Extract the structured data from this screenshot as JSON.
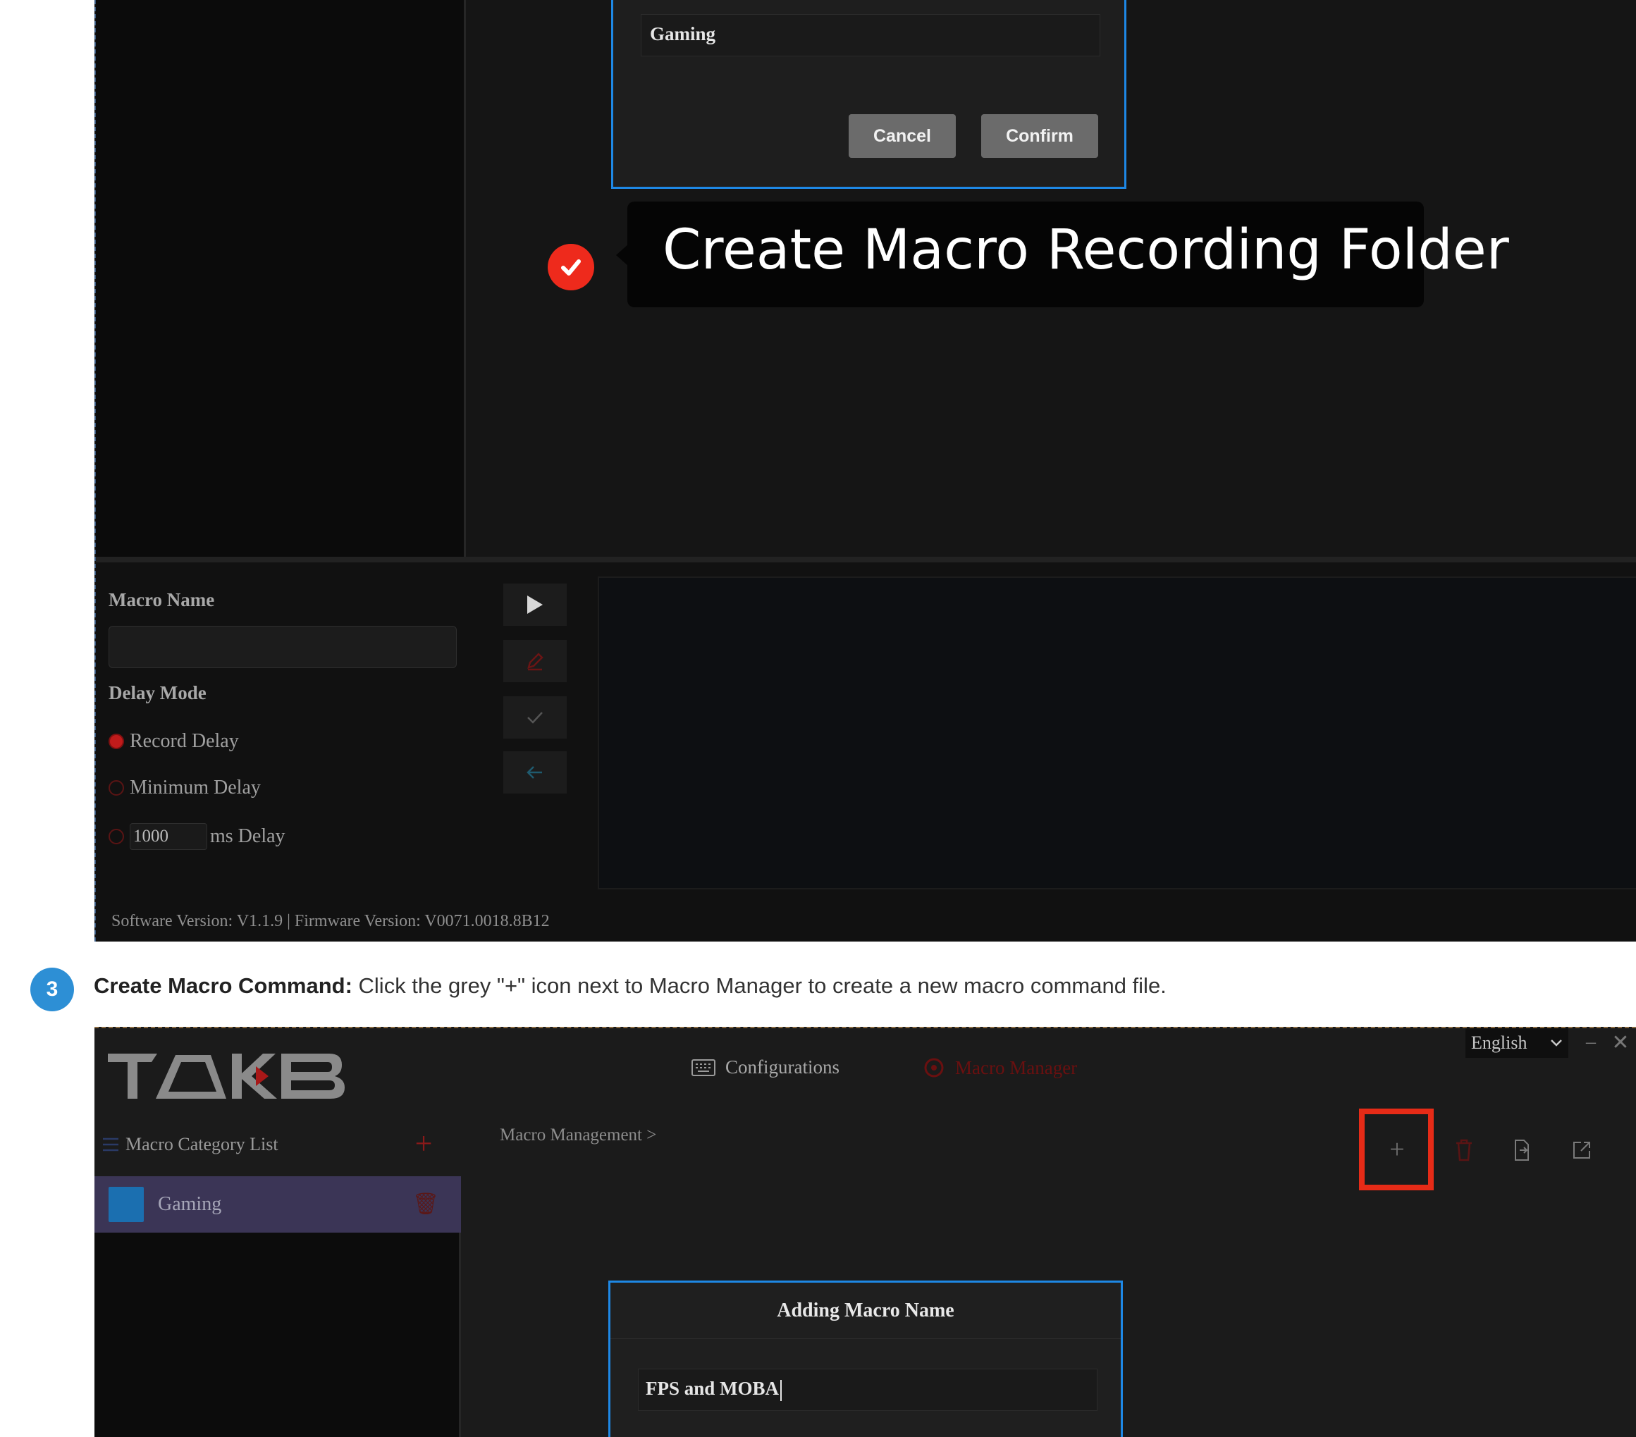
{
  "screenshot_1": {
    "folder_dialog": {
      "input_value": "Gaming",
      "cancel_label": "Cancel",
      "confirm_label": "Confirm"
    },
    "callout": {
      "text": "Create Macro Recording Folder"
    },
    "macro_editor": {
      "macro_name_label": "Macro Name",
      "macro_name_value": "",
      "delay_mode_label": "Delay Mode",
      "delay_options": [
        {
          "label": "Record Delay",
          "selected": true
        },
        {
          "label": "Minimum Delay",
          "selected": false
        },
        {
          "label": "ms Delay",
          "selected": false,
          "ms_value": "1000"
        }
      ]
    },
    "version_line": "Software Version:  V1.1.9  |  Firmware Version:  V0071.0018.8B12"
  },
  "step": {
    "number": "3",
    "title": "Create Macro Command:",
    "description": " Click the grey \"+\" icon next to Macro Manager to create a new macro command file."
  },
  "screenshot_2": {
    "logo_text": "TAKB",
    "nav": {
      "configurations_label": "Configurations",
      "macro_label": "Macro Manager"
    },
    "language": "English",
    "category_list_label": "Macro Category List",
    "categories": [
      {
        "label": "Gaming",
        "selected": true
      }
    ],
    "breadcrumb": "Macro Management >",
    "dialog": {
      "title": "Adding Macro Name",
      "input_value": "FPS and MOBA"
    },
    "colors": {
      "accent_blue": "#1e88e5",
      "highlight_red": "#e62b17",
      "badge_blue": "#2d8fd5"
    }
  }
}
